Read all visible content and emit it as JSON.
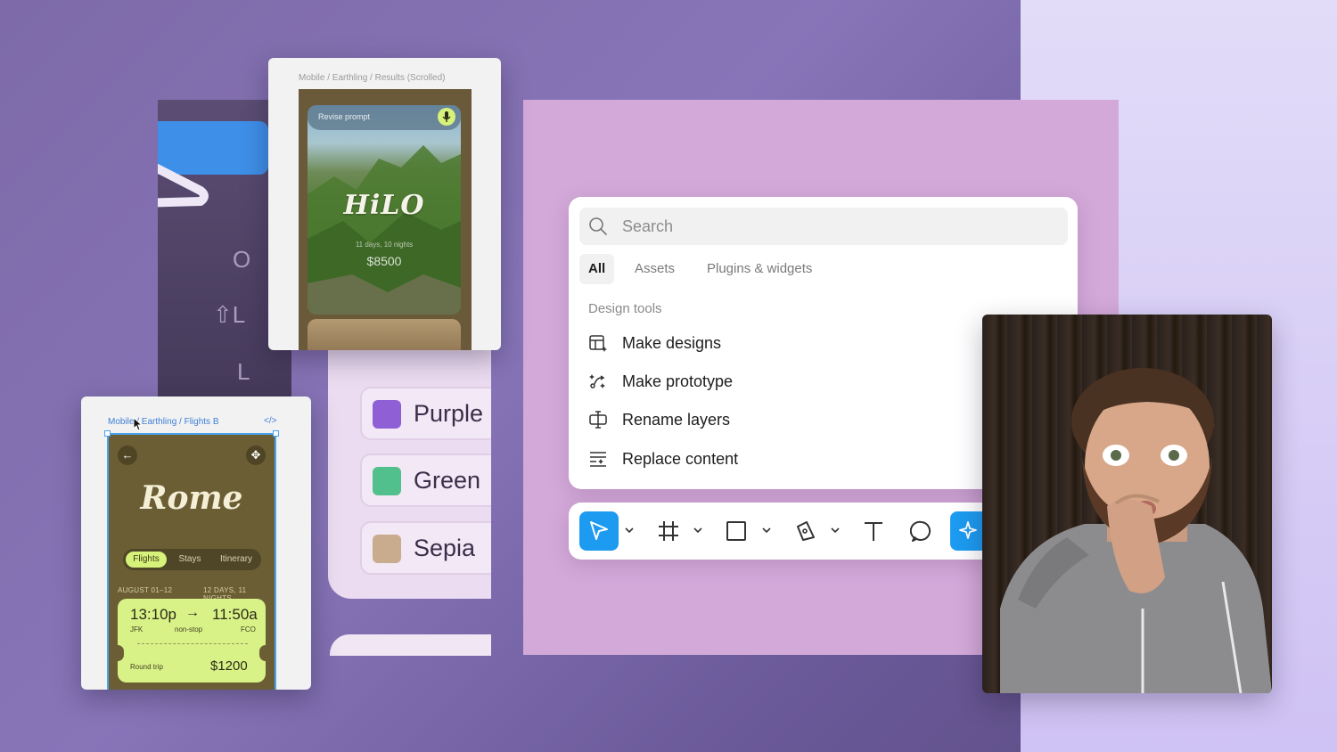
{
  "hilo_card": {
    "path": "Mobile / Earthling / Results (Scrolled)",
    "prompt_label": "Revise prompt",
    "title": "HiLO",
    "subtitle": "11 days, 10 nights",
    "price": "$8500"
  },
  "rome_card": {
    "path": "Mobile / Earthling / Flights B",
    "code_label": "</>",
    "title": "Rome",
    "tabs": [
      "Flights",
      "Stays",
      "Itinerary"
    ],
    "dates": "AUGUST 01–12",
    "nights": "12 DAYS, 11 NIGHTS",
    "ticket": {
      "depart_time": "13:10p",
      "arrive_time": "11:50a",
      "arrow": "→",
      "from": "JFK",
      "stops": "non-stop",
      "to": "FCO",
      "trip_type": "Round trip",
      "price": "$1200"
    }
  },
  "keyboard_panel": {
    "keys": [
      "O",
      "⇧L",
      "L"
    ]
  },
  "colors": {
    "items": [
      {
        "label": "Purple",
        "swatch": "#8f5fd6"
      },
      {
        "label": "Green",
        "swatch": "#52c08c"
      },
      {
        "label": "Sepia",
        "swatch": "#c9ab8d"
      }
    ]
  },
  "palette": {
    "search_placeholder": "Search",
    "tabs": [
      "All",
      "Assets",
      "Plugins & widgets"
    ],
    "section_label": "Design tools",
    "items": [
      {
        "label": "Make designs",
        "icon": "layout-sparkle-icon"
      },
      {
        "label": "Make prototype",
        "icon": "prototype-icon"
      },
      {
        "label": "Rename layers",
        "icon": "rename-icon"
      },
      {
        "label": "Replace content",
        "icon": "replace-content-icon"
      }
    ]
  },
  "toolbar": {
    "tools": [
      "move-tool",
      "frame-tool",
      "shape-tool",
      "pen-tool",
      "text-tool",
      "comment-tool",
      "ai-tool"
    ],
    "accent": "#1c9bf0"
  }
}
